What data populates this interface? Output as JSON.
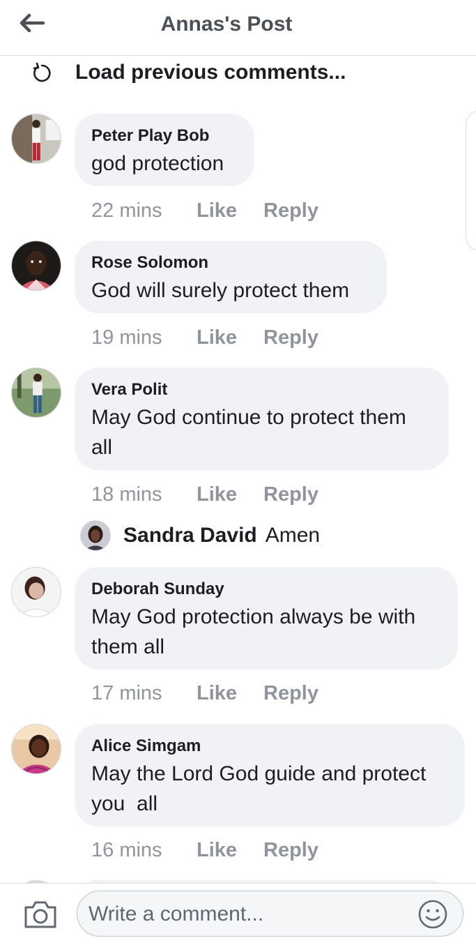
{
  "header": {
    "title": "Annas's Post",
    "back_icon": "back-arrow-icon"
  },
  "load_previous": {
    "label": "Load previous comments...",
    "icon": "refresh-icon"
  },
  "comments": [
    {
      "author": "Peter Play Bob",
      "text": "god protection",
      "time": "22 mins",
      "like": "Like",
      "reply": "Reply"
    },
    {
      "author": "Rose Solomon",
      "text": "God will surely protect them",
      "time": "19 mins",
      "like": "Like",
      "reply": "Reply"
    },
    {
      "author": "Vera Polit",
      "text": "May God continue to protect them all",
      "time": "18 mins",
      "like": "Like",
      "reply": "Reply"
    },
    {
      "author": "Deborah Sunday",
      "text": "May God protection always be with them all",
      "time": "17 mins",
      "like": "Like",
      "reply": "Reply"
    },
    {
      "author": "Alice Simgam",
      "text": "May the Lord God guide and protect you  all",
      "time": "16 mins",
      "like": "Like",
      "reply": "Reply"
    }
  ],
  "reply_preview": {
    "author": "Sandra David",
    "text": "Amen"
  },
  "composer": {
    "placeholder": "Write a comment...",
    "value": "",
    "camera_icon": "camera-icon",
    "emoji_icon": "emoji-icon"
  },
  "colors": {
    "bubble": "#f0f2f5",
    "meta_text": "#90949c",
    "title_text": "#4b4f56"
  }
}
